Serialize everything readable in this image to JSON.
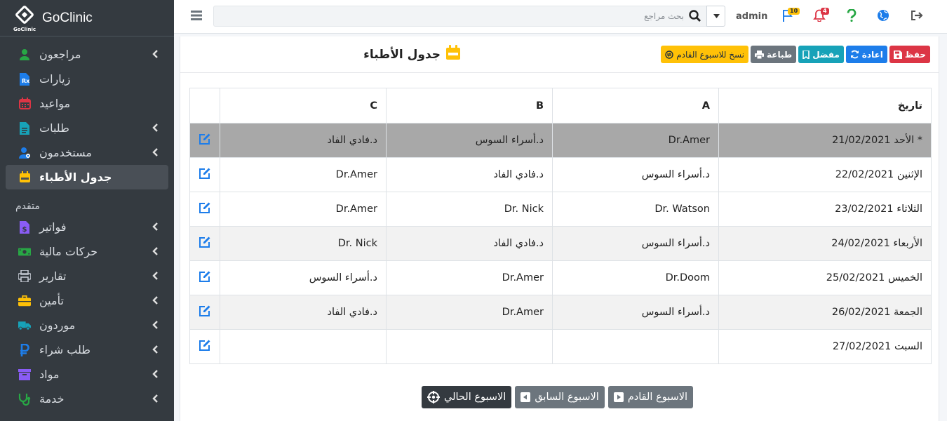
{
  "brand": {
    "name": "GoClinic",
    "logo_text": "GoClinic"
  },
  "sidebar": {
    "items": [
      {
        "label": "مراجعون",
        "icon": "user-icon",
        "chevron": true
      },
      {
        "label": "زيارات",
        "icon": "prescription-icon",
        "chevron": false
      },
      {
        "label": "مواعيد",
        "icon": "calendar-icon",
        "chevron": false
      },
      {
        "label": "طلبات",
        "icon": "file-icon",
        "chevron": true
      },
      {
        "label": "مستخدمون",
        "icon": "users-cog-icon",
        "chevron": true
      },
      {
        "label": "جدول الأطباء",
        "icon": "calendar-week-icon",
        "chevron": false,
        "active": true
      }
    ],
    "section_header": "متقدم",
    "advanced_items": [
      {
        "label": "فواتير",
        "icon": "invoice-icon",
        "chevron": true
      },
      {
        "label": "حركات مالية",
        "icon": "money-icon",
        "chevron": true
      },
      {
        "label": "تقارير",
        "icon": "print-icon",
        "chevron": true
      },
      {
        "label": "تأمين",
        "icon": "briefcase-icon",
        "chevron": true
      },
      {
        "label": "موردون",
        "icon": "truck-icon",
        "chevron": true
      },
      {
        "label": "طلب شراء",
        "icon": "ruble-icon",
        "chevron": true
      },
      {
        "label": "مواد",
        "icon": "archive-icon",
        "chevron": true
      },
      {
        "label": "خدمة",
        "icon": "stethoscope-icon",
        "chevron": true
      }
    ]
  },
  "topbar": {
    "search_placeholder": "بحث مراجع",
    "user": "admin",
    "flag_badge": "10",
    "bell_badge": "4"
  },
  "page": {
    "title": "جدول الأطباء",
    "toolbar": {
      "save": "حفظ",
      "reload": "اعادة",
      "favorite": "مفضل",
      "print": "طباعة",
      "copy_next": "نسخ للاسبوع القادم"
    }
  },
  "table": {
    "headers": {
      "date": "تاريخ",
      "a": "A",
      "b": "B",
      "c": "C"
    },
    "rows": [
      {
        "day": "* الأحد",
        "date": "21/02/2021",
        "a": "Dr.Amer",
        "b": "د.أسراء السوس",
        "c": "د.فادي الفاد"
      },
      {
        "day": "الإثنين",
        "date": "22/02/2021",
        "a": "د.أسراء السوس",
        "b": "د.فادي الفاد",
        "c": "Dr.Amer"
      },
      {
        "day": "الثلاثاء",
        "date": "23/02/2021",
        "a": "Dr. Watson",
        "b": "Dr. Nick",
        "c": "Dr.Amer"
      },
      {
        "day": "الأربعاء",
        "date": "24/02/2021",
        "a": "د.أسراء السوس",
        "b": "د.فادي الفاد",
        "c": "Dr. Nick"
      },
      {
        "day": "الخميس",
        "date": "25/02/2021",
        "a": "Dr.Doom",
        "b": "Dr.Amer",
        "c": "د.أسراء السوس"
      },
      {
        "day": "الجمعة",
        "date": "26/02/2021",
        "a": "د.أسراء السوس",
        "b": "Dr.Amer",
        "c": "د.فادي الفاد"
      },
      {
        "day": "السبت",
        "date": "27/02/2021",
        "a": "",
        "b": "",
        "c": ""
      }
    ]
  },
  "week_nav": {
    "next": "الاسبوع القادم",
    "prev": "الاسبوع السابق",
    "current": "الاسبوع الحالي"
  },
  "colors": {
    "sidebar_bg": "#343a40",
    "danger": "#dc3545",
    "primary": "#1d7dea",
    "info": "#17a2b8",
    "secondary": "#6c757d",
    "warning": "#ffc107",
    "selected_row": "#a8a8a8"
  }
}
